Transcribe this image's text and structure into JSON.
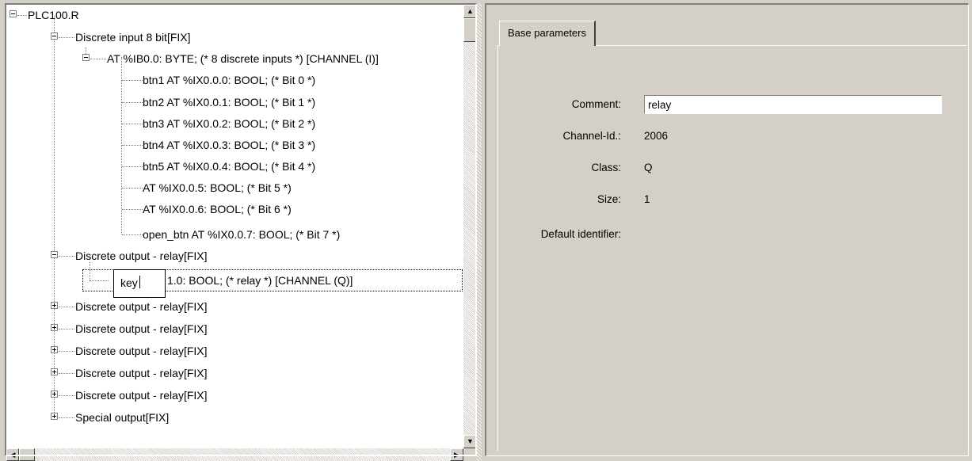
{
  "tree": {
    "root": "PLC100.R",
    "rows": [
      {
        "label": "Discrete input 8 bit[FIX]"
      },
      {
        "label": "AT %IB0.0: BYTE; (* 8 discrete inputs *) [CHANNEL (I)]"
      },
      {
        "label": "btn1 AT %IX0.0.0: BOOL; (* Bit 0 *)"
      },
      {
        "label": "btn2 AT %IX0.0.1: BOOL; (* Bit 1 *)"
      },
      {
        "label": "btn3 AT %IX0.0.2: BOOL; (* Bit 2 *)"
      },
      {
        "label": "btn4 AT %IX0.0.3: BOOL; (* Bit 3 *)"
      },
      {
        "label": "btn5 AT %IX0.0.4: BOOL; (* Bit 4 *)"
      },
      {
        "label": " AT %IX0.0.5: BOOL; (* Bit 5 *)"
      },
      {
        "label": " AT %IX0.0.6: BOOL; (* Bit 6 *)"
      },
      {
        "label": "open_btn AT %IX0.0.7: BOOL; (* Bit 7 *)"
      },
      {
        "label": "Discrete output - relay[FIX]"
      },
      {
        "label": "1.0: BOOL; (* relay *) [CHANNEL (Q)]"
      },
      {
        "label": "Discrete output - relay[FIX]"
      },
      {
        "label": "Discrete output - relay[FIX]"
      },
      {
        "label": "Discrete output - relay[FIX]"
      },
      {
        "label": "Discrete output - relay[FIX]"
      },
      {
        "label": "Discrete output - relay[FIX]"
      },
      {
        "label": "Special output[FIX]"
      }
    ],
    "edit_value": "key"
  },
  "properties": {
    "tab_label": "Base parameters",
    "comment_label": "Comment:",
    "comment_value": "relay",
    "channel_label": "Channel-Id.:",
    "channel_value": "2006",
    "class_label": "Class:",
    "class_value": "Q",
    "size_label": "Size:",
    "size_value": "1",
    "default_label": "Default identifier:"
  }
}
